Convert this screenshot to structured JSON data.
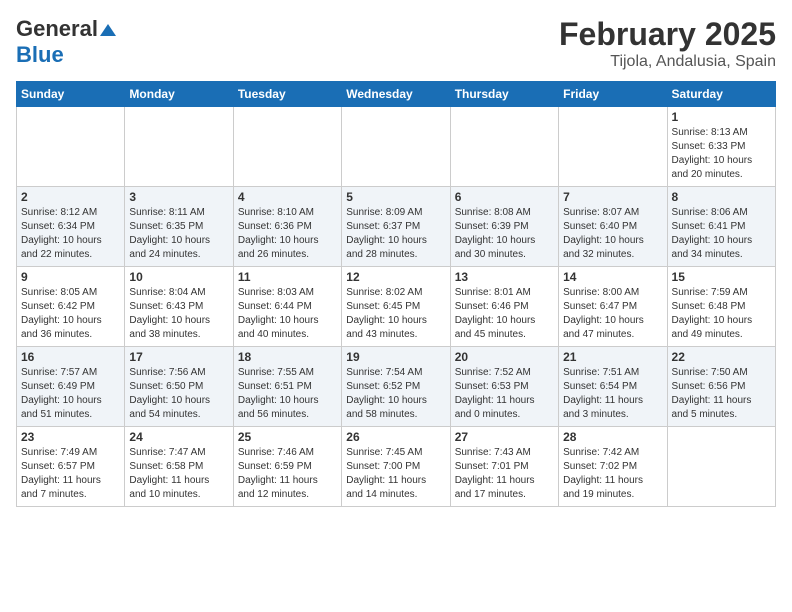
{
  "header": {
    "logo_line1": "General",
    "logo_line2": "Blue",
    "main_title": "February 2025",
    "sub_title": "Tijola, Andalusia, Spain"
  },
  "calendar": {
    "days_of_week": [
      "Sunday",
      "Monday",
      "Tuesday",
      "Wednesday",
      "Thursday",
      "Friday",
      "Saturday"
    ],
    "weeks": [
      [
        {
          "day": "",
          "info": ""
        },
        {
          "day": "",
          "info": ""
        },
        {
          "day": "",
          "info": ""
        },
        {
          "day": "",
          "info": ""
        },
        {
          "day": "",
          "info": ""
        },
        {
          "day": "",
          "info": ""
        },
        {
          "day": "1",
          "info": "Sunrise: 8:13 AM\nSunset: 6:33 PM\nDaylight: 10 hours\nand 20 minutes."
        }
      ],
      [
        {
          "day": "2",
          "info": "Sunrise: 8:12 AM\nSunset: 6:34 PM\nDaylight: 10 hours\nand 22 minutes."
        },
        {
          "day": "3",
          "info": "Sunrise: 8:11 AM\nSunset: 6:35 PM\nDaylight: 10 hours\nand 24 minutes."
        },
        {
          "day": "4",
          "info": "Sunrise: 8:10 AM\nSunset: 6:36 PM\nDaylight: 10 hours\nand 26 minutes."
        },
        {
          "day": "5",
          "info": "Sunrise: 8:09 AM\nSunset: 6:37 PM\nDaylight: 10 hours\nand 28 minutes."
        },
        {
          "day": "6",
          "info": "Sunrise: 8:08 AM\nSunset: 6:39 PM\nDaylight: 10 hours\nand 30 minutes."
        },
        {
          "day": "7",
          "info": "Sunrise: 8:07 AM\nSunset: 6:40 PM\nDaylight: 10 hours\nand 32 minutes."
        },
        {
          "day": "8",
          "info": "Sunrise: 8:06 AM\nSunset: 6:41 PM\nDaylight: 10 hours\nand 34 minutes."
        }
      ],
      [
        {
          "day": "9",
          "info": "Sunrise: 8:05 AM\nSunset: 6:42 PM\nDaylight: 10 hours\nand 36 minutes."
        },
        {
          "day": "10",
          "info": "Sunrise: 8:04 AM\nSunset: 6:43 PM\nDaylight: 10 hours\nand 38 minutes."
        },
        {
          "day": "11",
          "info": "Sunrise: 8:03 AM\nSunset: 6:44 PM\nDaylight: 10 hours\nand 40 minutes."
        },
        {
          "day": "12",
          "info": "Sunrise: 8:02 AM\nSunset: 6:45 PM\nDaylight: 10 hours\nand 43 minutes."
        },
        {
          "day": "13",
          "info": "Sunrise: 8:01 AM\nSunset: 6:46 PM\nDaylight: 10 hours\nand 45 minutes."
        },
        {
          "day": "14",
          "info": "Sunrise: 8:00 AM\nSunset: 6:47 PM\nDaylight: 10 hours\nand 47 minutes."
        },
        {
          "day": "15",
          "info": "Sunrise: 7:59 AM\nSunset: 6:48 PM\nDaylight: 10 hours\nand 49 minutes."
        }
      ],
      [
        {
          "day": "16",
          "info": "Sunrise: 7:57 AM\nSunset: 6:49 PM\nDaylight: 10 hours\nand 51 minutes."
        },
        {
          "day": "17",
          "info": "Sunrise: 7:56 AM\nSunset: 6:50 PM\nDaylight: 10 hours\nand 54 minutes."
        },
        {
          "day": "18",
          "info": "Sunrise: 7:55 AM\nSunset: 6:51 PM\nDaylight: 10 hours\nand 56 minutes."
        },
        {
          "day": "19",
          "info": "Sunrise: 7:54 AM\nSunset: 6:52 PM\nDaylight: 10 hours\nand 58 minutes."
        },
        {
          "day": "20",
          "info": "Sunrise: 7:52 AM\nSunset: 6:53 PM\nDaylight: 11 hours\nand 0 minutes."
        },
        {
          "day": "21",
          "info": "Sunrise: 7:51 AM\nSunset: 6:54 PM\nDaylight: 11 hours\nand 3 minutes."
        },
        {
          "day": "22",
          "info": "Sunrise: 7:50 AM\nSunset: 6:56 PM\nDaylight: 11 hours\nand 5 minutes."
        }
      ],
      [
        {
          "day": "23",
          "info": "Sunrise: 7:49 AM\nSunset: 6:57 PM\nDaylight: 11 hours\nand 7 minutes."
        },
        {
          "day": "24",
          "info": "Sunrise: 7:47 AM\nSunset: 6:58 PM\nDaylight: 11 hours\nand 10 minutes."
        },
        {
          "day": "25",
          "info": "Sunrise: 7:46 AM\nSunset: 6:59 PM\nDaylight: 11 hours\nand 12 minutes."
        },
        {
          "day": "26",
          "info": "Sunrise: 7:45 AM\nSunset: 7:00 PM\nDaylight: 11 hours\nand 14 minutes."
        },
        {
          "day": "27",
          "info": "Sunrise: 7:43 AM\nSunset: 7:01 PM\nDaylight: 11 hours\nand 17 minutes."
        },
        {
          "day": "28",
          "info": "Sunrise: 7:42 AM\nSunset: 7:02 PM\nDaylight: 11 hours\nand 19 minutes."
        },
        {
          "day": "",
          "info": ""
        }
      ]
    ]
  }
}
